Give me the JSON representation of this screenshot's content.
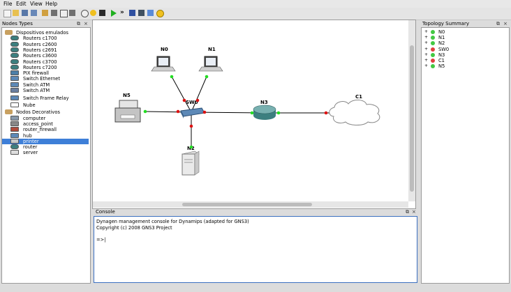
{
  "menu": [
    "File",
    "Edit",
    "View",
    "Help"
  ],
  "toolbar_icons": [
    "new-icon",
    "open-icon",
    "save-icon",
    "save-as-icon",
    "pointer-icon",
    "select-icon",
    "interface-icon",
    "capture-icon",
    "power-icon",
    "play-icon",
    "fast-forward-icon",
    "suspend-icon",
    "stop-icon",
    "screenshot-icon",
    "rectangle-icon",
    "ellipse-icon"
  ],
  "left_dock": {
    "title": "Nodes Types",
    "categories": [
      {
        "label": "Dispositivos emulados",
        "items": [
          {
            "label": "Routers c1700",
            "icon": "router-icon"
          },
          {
            "label": "Routers c2600",
            "icon": "router-icon"
          },
          {
            "label": "Routers c2691",
            "icon": "router-icon"
          },
          {
            "label": "Routers c3600",
            "icon": "router-icon"
          },
          {
            "label": "Routers c3700",
            "icon": "router-icon"
          },
          {
            "label": "Routers c7200",
            "icon": "router-icon"
          },
          {
            "label": "PIX firewall",
            "icon": "firewall-icon"
          },
          {
            "label": "Switch Ethernet",
            "icon": "switch-icon"
          },
          {
            "label": "Switch ATM",
            "icon": "switch-icon"
          },
          {
            "label": "Switch ATM",
            "icon": "atm-icon"
          },
          {
            "label": "Switch Frame Relay",
            "icon": "frame-relay-icon"
          },
          {
            "label": "Nube",
            "icon": "cloud-icon"
          }
        ]
      },
      {
        "label": "Nodos Decorativos",
        "items": [
          {
            "label": "computer",
            "icon": "computer-icon"
          },
          {
            "label": "access_point",
            "icon": "access-point-icon"
          },
          {
            "label": "router_firewall",
            "icon": "router-firewall-icon"
          },
          {
            "label": "hub",
            "icon": "hub-icon"
          },
          {
            "label": "printer",
            "icon": "printer-icon",
            "selected": true
          },
          {
            "label": "router",
            "icon": "router-icon"
          },
          {
            "label": "server",
            "icon": "server-icon"
          }
        ]
      }
    ]
  },
  "canvas": {
    "nodes": [
      {
        "label": "N0",
        "type": "laptop"
      },
      {
        "label": "N1",
        "type": "laptop"
      },
      {
        "label": "N5",
        "type": "printer"
      },
      {
        "label": "SW0",
        "type": "switch"
      },
      {
        "label": "N3",
        "type": "router"
      },
      {
        "label": "C1",
        "type": "cloud"
      },
      {
        "label": "N2",
        "type": "server"
      }
    ],
    "link_colors": {
      "up": "#22dd22",
      "down": "#dd1111"
    }
  },
  "right_dock": {
    "title": "Topology Summary",
    "items": [
      {
        "label": "N0",
        "status_color": "#43c843"
      },
      {
        "label": "N1",
        "status_color": "#43c843"
      },
      {
        "label": "N2",
        "status_color": "#43c843"
      },
      {
        "label": "SW0",
        "status_color": "#e04040"
      },
      {
        "label": "N3",
        "status_color": "#43c843"
      },
      {
        "label": "C1",
        "status_color": "#e04040"
      },
      {
        "label": "N5",
        "status_color": "#43c843"
      }
    ]
  },
  "console": {
    "title": "Console",
    "lines": [
      "Dynagen management console for Dynamips (adapted for GNS3)",
      "Copyright (c) 2008 GNS3 Project",
      "",
      "=>|"
    ]
  }
}
